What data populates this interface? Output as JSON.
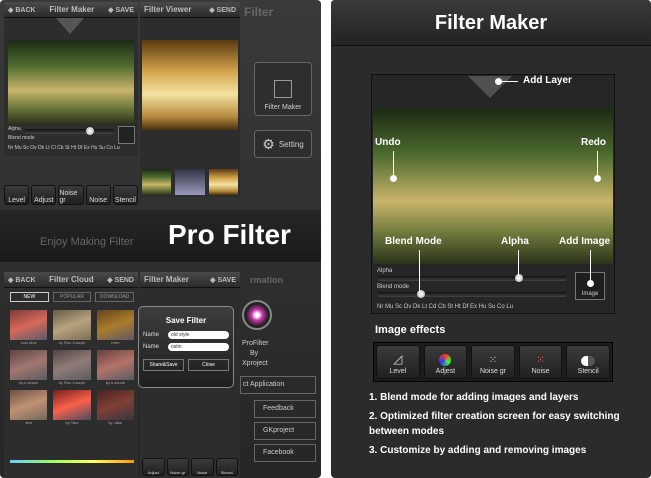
{
  "left": {
    "topbar1": {
      "back": "◆ BACK",
      "title": "Filter Maker",
      "save": "◆ SAVE"
    },
    "topbar2": {
      "title": "Filter Viewer",
      "send": "◆ SEND",
      "title2": "Filter"
    },
    "alpha": "Alpha",
    "blend": "Blend mode",
    "blend_letters": "Nr Mu Sc Ov Dk Lt Cl Cb St Ht Df Ex Hu Su Co Lu",
    "right_buttons": [
      {
        "label": "Filter Maker"
      },
      {
        "label": "Setting"
      }
    ],
    "effects": [
      "Level",
      "Adjust",
      "Noise gr",
      "Noise",
      "Stencil"
    ],
    "banner": "Pro Filter",
    "banner_sub": "Enjoy Making Filter",
    "bottom_bar": {
      "back": "◆ BACK",
      "title": "Filter Cloud",
      "send": "◆ SEND",
      "title2": "Filter Maker",
      "save": "◆ SAVE",
      "info": "rmation"
    },
    "tabs": [
      "NEW",
      "POPULAR",
      "DOWNLOAD"
    ],
    "grid_captions": [
      "cool blue",
      "by Ron Joseph",
      "retro",
      "by k.shunk",
      "by Ron Joseph",
      "by k.shunk",
      "test",
      "by Taro",
      "by Jake",
      "by Jake",
      "by Jake",
      "by Jake"
    ],
    "dialog": {
      "title": "Save Filter",
      "name_label": "Name",
      "name_value": "old style",
      "author_label": "Name",
      "author_value": "ostin",
      "share": "Share&Save",
      "close": "Close"
    },
    "side_labels": [
      "ProFilter",
      "By",
      "Xproject",
      "ct Application",
      "Feedback",
      "GKproject",
      "Facebook"
    ]
  },
  "right": {
    "title": "Filter Maker",
    "add_layer": "Add Layer",
    "undo": "Undo",
    "redo": "Redo",
    "blend_mode": "Blend Mode",
    "alpha_callout": "Alpha",
    "add_image": "Add Image",
    "alpha": "Alpha",
    "blend": "Blend mode",
    "blend_letters": "Nr  Mu  Sc  Ov  Dk  Lt  Cd  Cb  St  Ht  Df  Ex  Hu  Su  Co  Lu",
    "image_button": "Image",
    "image_effects": "Image effects",
    "effects": [
      "Level",
      "Adjest",
      "Noise gr",
      "Noise",
      "Stencil"
    ],
    "features": [
      "1. Blend mode for adding images and layers",
      "2. Optimized filter creation screen for easy switching between modes",
      "3. Customize by adding and removing images"
    ]
  }
}
